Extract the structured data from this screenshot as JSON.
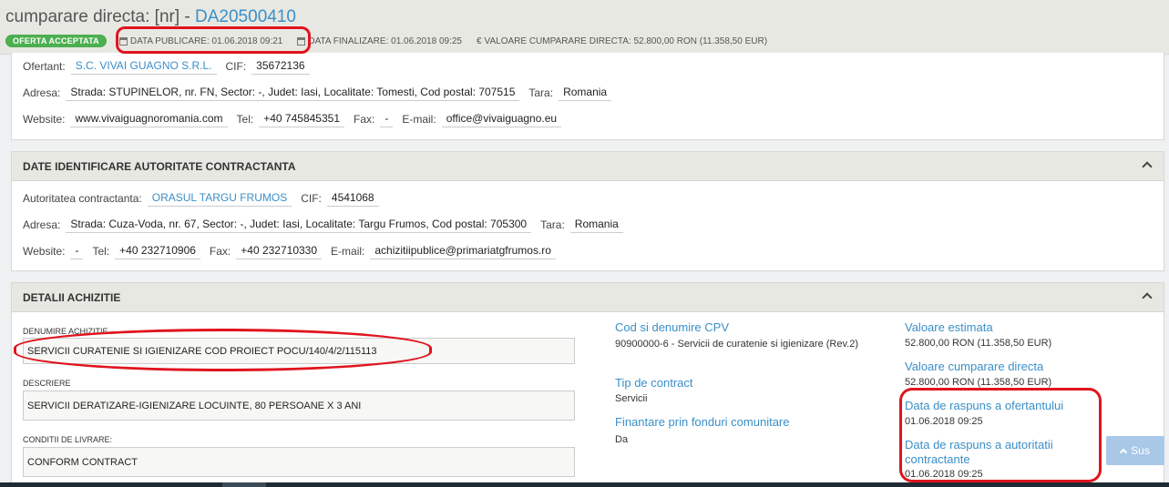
{
  "header": {
    "title_prefix": "cumparare directa: [nr] - ",
    "code": "DA20500410",
    "badge": "OFERTA ACCEPTATA",
    "data_publicare": "DATA PUBLICARE: 01.06.2018 09:21",
    "data_finalizare": "DATA FINALIZARE: 01.06.2018 09:25",
    "valoare": "VALOARE CUMPARARE DIRECTA: 52.800,00  RON (11.358,50  EUR)",
    "icons": {
      "calendar": "calendar-icon",
      "currency": "euro-icon"
    }
  },
  "ofertant": {
    "ofertant_label": "Ofertant:",
    "ofertant_value": "S.C. VIVAI GUAGNO S.R.L.",
    "cif_label": "CIF:",
    "cif_value": "35672136",
    "adresa_label": "Adresa:",
    "adresa_value": "Strada: STUPINELOR, nr. FN, Sector: -, Judet: Iasi, Localitate: Tomesti, Cod postal: 707515",
    "tara_label": "Tara:",
    "tara_value": "Romania",
    "website_label": "Website:",
    "website_value": "www.vivaiguagnoromania.com",
    "tel_label": "Tel:",
    "tel_value": "+40 745845351",
    "fax_label": "Fax:",
    "fax_value": "-",
    "email_label": "E-mail:",
    "email_value": "office@vivaiguagno.eu"
  },
  "autoritate": {
    "heading": "DATE IDENTIFICARE AUTORITATE CONTRACTANTA",
    "autoritate_label": "Autoritatea contractanta:",
    "autoritate_value": "ORASUL TARGU FRUMOS",
    "cif_label": "CIF:",
    "cif_value": "4541068",
    "adresa_label": "Adresa:",
    "adresa_value": "Strada: Cuza-Voda, nr. 67, Sector: -, Judet: Iasi, Localitate: Targu Frumos, Cod postal: 705300",
    "tara_label": "Tara:",
    "tara_value": "Romania",
    "website_label": "Website:",
    "website_value": "-",
    "tel_label": "Tel:",
    "tel_value": "+40 232710906",
    "fax_label": "Fax:",
    "fax_value": "+40 232710330",
    "email_label": "E-mail:",
    "email_value": "achizitiipublice@primariatgfrumos.ro"
  },
  "detalii": {
    "heading": "DETALII ACHIZITIE",
    "denumire_label": "DENUMIRE ACHIZITIE",
    "denumire_value": "SERVICII CURATENIE SI IGIENIZARE COD PROIECT POCU/140/4/2/115113",
    "descriere_label": "DESCRIERE",
    "descriere_value": "SERVICII DERATIZARE-IGIENIZARE LOCUINTE, 80 PERSOANE X 3 ANI",
    "conditii_label": "CONDITII DE LIVRARE:",
    "conditii_value": "CONFORM CONTRACT",
    "cpv_label": "Cod si denumire CPV",
    "cpv_value": "90900000-6 - Servicii de curatenie si igienizare (Rev.2)",
    "tip_label": "Tip de contract",
    "tip_value": "Servicii",
    "finantare_label": "Finantare prin fonduri comunitare",
    "finantare_value": "Da",
    "val_estimata_label": "Valoare estimata",
    "val_estimata_value": "52.800,00  RON (11.358,50  EUR)",
    "val_cumparare_label": "Valoare cumparare directa",
    "val_cumparare_value": "52.800,00  RON (11.358,50  EUR)",
    "raspuns_ofertant_label": "Data de raspuns a ofertantului",
    "raspuns_ofertant_value": "01.06.2018 09:25",
    "raspuns_autoritate_label": "Data de raspuns a autoritatii contractante",
    "raspuns_autoritate_value": "01.06.2018 09:25"
  },
  "scroll_top": {
    "label": "Sus"
  },
  "colors": {
    "link": "#3a8fc8",
    "badge": "#4caf50",
    "annotation": "#e0141e",
    "panel_header": "#e8e8e3"
  }
}
